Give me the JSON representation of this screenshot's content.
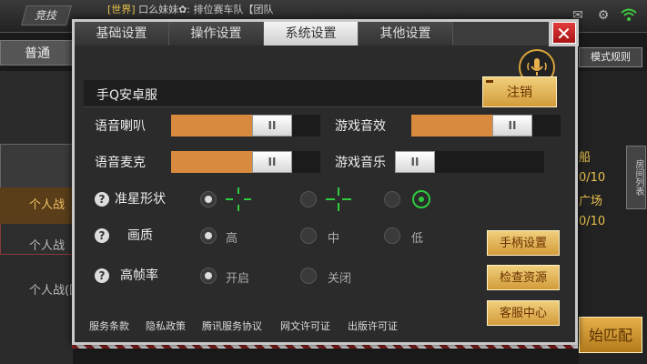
{
  "background": {
    "compete_tab": "竞技",
    "chat_world": "[世界]",
    "chat_text": "口么妹妹✿: 排位赛车队【团队",
    "normal_tab": "普通",
    "mode_rules": "模式规则",
    "left_items": [
      "个人战",
      "个人战",
      "个人战(团"
    ],
    "right_texts": [
      "船",
      "0/10",
      "广场",
      "0/10"
    ],
    "room_list": "房间列表",
    "start_match": "始匹配"
  },
  "dialog": {
    "tabs": [
      {
        "label": "基础设置",
        "active": false
      },
      {
        "label": "操作设置",
        "active": false
      },
      {
        "label": "系统设置",
        "active": true
      },
      {
        "label": "其他设置",
        "active": false
      }
    ],
    "close_label": "✕",
    "account_text": "手Q安卓服",
    "logout_label": "注销",
    "sliders": {
      "voice_speaker": {
        "label": "语音喇叭",
        "level": 0.74,
        "knob": "II"
      },
      "game_sfx": {
        "label": "游戏音效",
        "level": 0.74,
        "knob": "II"
      },
      "voice_mic": {
        "label": "语音麦克",
        "level": 0.74,
        "knob": "II"
      },
      "game_music": {
        "label": "游戏音乐",
        "level": 0.0,
        "knob": "II"
      }
    },
    "crosshair": {
      "label": "准星形状",
      "selected": 0
    },
    "quality": {
      "label": "画质",
      "options": [
        "高",
        "中",
        "低"
      ],
      "selected": 0
    },
    "high_fps": {
      "label": "高帧率",
      "options": [
        "开启",
        "关闭"
      ],
      "selected": 0
    },
    "side_buttons": [
      "手柄设置",
      "检查资源",
      "客服中心"
    ],
    "footer_links": [
      "服务条款",
      "隐私政策",
      "腾讯服务协议",
      "网文许可证",
      "出版许可证"
    ],
    "help_glyph": "?"
  },
  "colors": {
    "accent_orange": "#d88a3e",
    "gold_button": "#d29c3a",
    "crosshair_green": "#2ecc40",
    "close_red": "#c62828"
  }
}
